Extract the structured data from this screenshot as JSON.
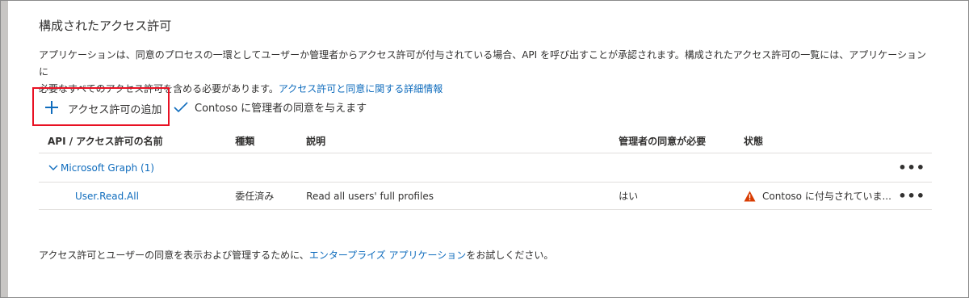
{
  "section": {
    "title": "構成されたアクセス許可",
    "description_line1": "アプリケーションは、同意のプロセスの一環としてユーザーか管理者からアクセス許可が付与されている場合、API を呼び出すことが承認されます。構成されたアクセス許可の一覧には、アプリケーションに",
    "description_line2": "必要なすべてのアクセス許可を含める必要があります。",
    "description_link": "アクセス許可と同意に関する詳細情報"
  },
  "toolbar": {
    "add_permission_label": "アクセス許可の追加",
    "grant_consent_label": "Contoso に管理者の同意を与えます"
  },
  "table": {
    "headers": [
      "API / アクセス許可の名前",
      "種類",
      "説明",
      "管理者の同意が必要",
      "状態"
    ],
    "group": {
      "label": "Microsoft Graph (1)",
      "more": "•••"
    },
    "rows": [
      {
        "name": "User.Read.All",
        "type": "委任済み",
        "description": "Read all users' full profiles",
        "admin_consent": "はい",
        "status": "Contoso に付与されていま...",
        "more": "•••"
      }
    ]
  },
  "footer": {
    "prefix": "アクセス許可とユーザーの同意を表示および管理するために、",
    "link": "エンタープライズ アプリケーション",
    "suffix": "をお試しください。"
  },
  "colors": {
    "link": "#0f6cbd",
    "highlight": "#e81123",
    "warning": "#d83b01"
  },
  "icons": {
    "add": "plus-icon",
    "consent": "checkmark-icon",
    "group": "chevron-down-icon",
    "status": "warning-icon",
    "more": "more-icon"
  }
}
